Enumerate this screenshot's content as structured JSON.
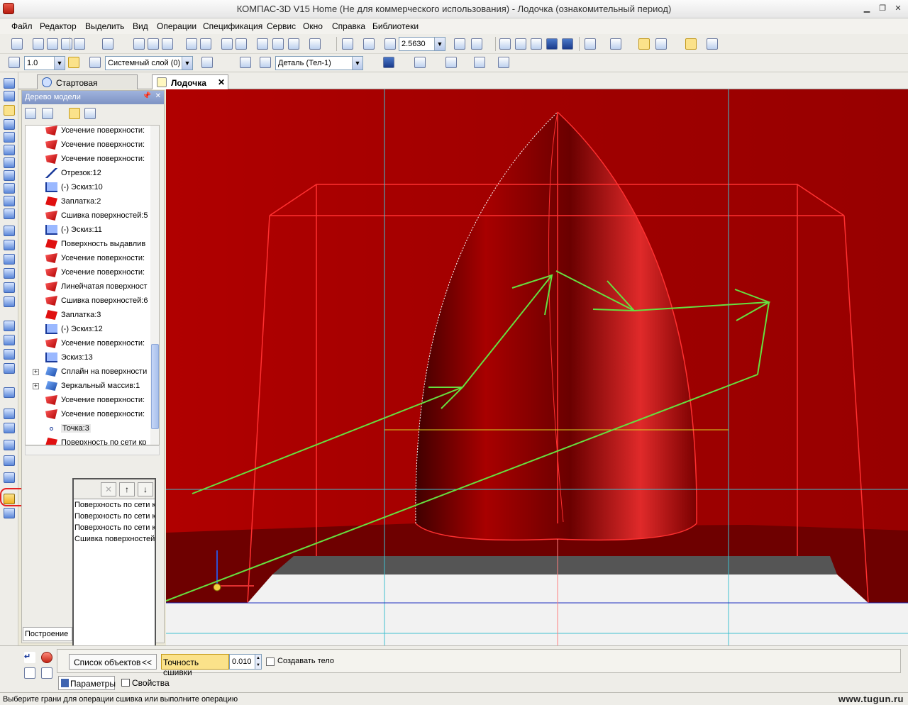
{
  "window": {
    "title": "КОМПАС-3D V15 Home (Не для коммерческого использования) - Лодочка (ознакомительный период)"
  },
  "menu": [
    "Файл",
    "Редактор",
    "Выделить",
    "Вид",
    "Операции",
    "Спецификация",
    "Сервис",
    "Окно",
    "Справка",
    "Библиотеки"
  ],
  "toolbar": {
    "zoom_value": "2.5630",
    "scale_value": "1.0",
    "layer_value": "Системный слой (0)",
    "part_value": "Деталь (Тел-1)"
  },
  "tabs": [
    {
      "label": "Стартовая страница"
    },
    {
      "label": "Лодочка"
    }
  ],
  "tree": {
    "header": "Дерево модели",
    "items": [
      {
        "label": "Усечение поверхности:",
        "icon": "surface-trim-icon"
      },
      {
        "label": "Усечение поверхности:",
        "icon": "surface-trim-icon"
      },
      {
        "label": "Усечение поверхности:",
        "icon": "surface-trim-icon"
      },
      {
        "label": "Отрезок:12",
        "icon": "segment-icon"
      },
      {
        "label": "(-) Эскиз:10",
        "icon": "sketch-icon"
      },
      {
        "label": "Заплатка:2",
        "icon": "patch-icon"
      },
      {
        "label": "Сшивка поверхностей:5",
        "icon": "stitch-icon"
      },
      {
        "label": "(-) Эскиз:11",
        "icon": "sketch-icon"
      },
      {
        "label": "Поверхность выдавлив",
        "icon": "extrude-surface-icon"
      },
      {
        "label": "Усечение поверхности:",
        "icon": "surface-trim-icon"
      },
      {
        "label": "Усечение поверхности:",
        "icon": "surface-trim-icon"
      },
      {
        "label": "Линейчатая поверхност",
        "icon": "ruled-surface-icon"
      },
      {
        "label": "Сшивка поверхностей:6",
        "icon": "stitch-icon"
      },
      {
        "label": "Заплатка:3",
        "icon": "patch-icon"
      },
      {
        "label": "(-) Эскиз:12",
        "icon": "sketch-icon"
      },
      {
        "label": "Усечение поверхности:",
        "icon": "surface-trim-icon"
      },
      {
        "label": "Эскиз:13",
        "icon": "sketch-icon"
      },
      {
        "label": "Сплайн на поверхности",
        "icon": "spline-icon"
      },
      {
        "label": "Зеркальный массив:1",
        "icon": "mirror-array-icon"
      },
      {
        "label": "Усечение поверхности:",
        "icon": "surface-trim-icon"
      },
      {
        "label": "Усечение поверхности:",
        "icon": "surface-trim-icon"
      },
      {
        "label": "Точка:3",
        "icon": "point-icon"
      },
      {
        "label": "Поверхность по сети кр",
        "icon": "network-surface-icon"
      }
    ],
    "footer_tab": "Построение"
  },
  "objects": {
    "items": [
      "Поверхность по сети к",
      "Поверхность по сети к",
      "Поверхность по сети к",
      "Сшивка поверхностей"
    ]
  },
  "bottom": {
    "list_button": "Список объектов",
    "collapse": "<<",
    "precision_label": "Точность сшивки",
    "precision_value": "0.010",
    "create_body_label": "Создавать тело",
    "tab_params": "Параметры",
    "tab_props": "Свойства"
  },
  "status": {
    "text": "Выберите грани для операции сшивка или выполните операцию",
    "watermark": "www.tugun.ru"
  },
  "colors": {
    "model": "#c00000",
    "annotation": "#66e040",
    "highlight": "#e62020"
  }
}
